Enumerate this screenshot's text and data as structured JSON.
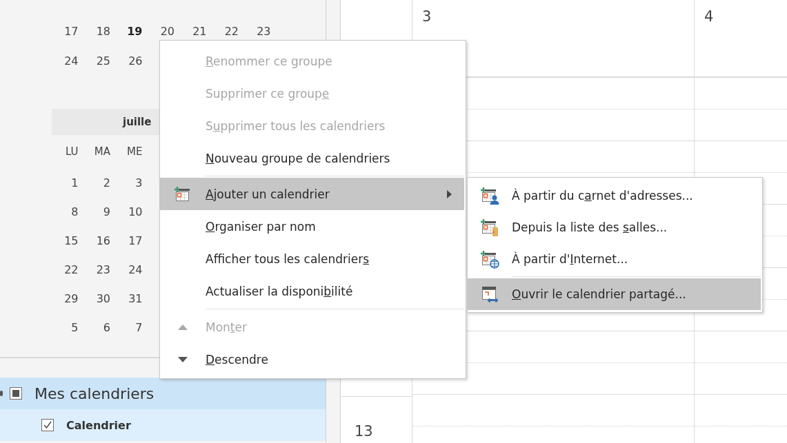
{
  "mini_calendar": {
    "rows_top": [
      {
        "days": [
          {
            "label": "17",
            "today": false
          },
          {
            "label": "18",
            "today": false
          },
          {
            "label": "19",
            "today": true
          },
          {
            "label": "20",
            "today": false
          },
          {
            "label": "21",
            "today": false
          },
          {
            "label": "22",
            "today": false
          },
          {
            "label": "23",
            "today": false
          }
        ]
      },
      {
        "days": [
          {
            "label": "24",
            "today": false
          },
          {
            "label": "25",
            "today": false
          },
          {
            "label": "26",
            "today": false
          }
        ]
      }
    ],
    "month_title": "juille",
    "weekdays": [
      "LU",
      "MA",
      "ME"
    ],
    "rows": [
      {
        "days": [
          {
            "label": "1",
            "today": false
          },
          {
            "label": "2",
            "today": false
          },
          {
            "label": "3",
            "today": false
          }
        ]
      },
      {
        "days": [
          {
            "label": "8",
            "today": false
          },
          {
            "label": "9",
            "today": false
          },
          {
            "label": "10",
            "today": false
          }
        ]
      },
      {
        "days": [
          {
            "label": "15",
            "today": false
          },
          {
            "label": "16",
            "today": false
          },
          {
            "label": "17",
            "today": false
          }
        ]
      },
      {
        "days": [
          {
            "label": "22",
            "today": false
          },
          {
            "label": "23",
            "today": false
          },
          {
            "label": "24",
            "today": false
          }
        ]
      },
      {
        "days": [
          {
            "label": "29",
            "today": false
          },
          {
            "label": "30",
            "today": false
          },
          {
            "label": "31",
            "today": false
          }
        ]
      },
      {
        "days": [
          {
            "label": "5",
            "today": false
          },
          {
            "label": "6",
            "today": false
          },
          {
            "label": "7",
            "today": false
          }
        ]
      }
    ]
  },
  "calendar_groups": [
    {
      "label": "Mes calendriers",
      "checked": true,
      "partial": true,
      "calendars": [
        {
          "label": "Calendrier",
          "checked": true
        }
      ]
    }
  ],
  "day_columns": [
    {
      "date": "3"
    },
    {
      "date": "4"
    }
  ],
  "time_labels": [
    "13"
  ],
  "context_menu": {
    "items": [
      {
        "kind": "item",
        "access_key": "R",
        "label_end": "enommer ce groupe",
        "disabled": true,
        "selected": false
      },
      {
        "kind": "item",
        "label_start": "Supprimer ce group",
        "access_key": "e",
        "disabled": true,
        "selected": false
      },
      {
        "kind": "item",
        "label_start": "S",
        "access_key": "u",
        "label_end": "pprimer tous les calendriers",
        "disabled": true,
        "selected": false
      },
      {
        "kind": "item",
        "access_key": "N",
        "label_end": "ouveau groupe de calendriers",
        "disabled": false,
        "selected": false
      },
      {
        "kind": "separator"
      },
      {
        "kind": "item",
        "access_key": "A",
        "label_end": "jouter un calendrier",
        "disabled": false,
        "selected": true,
        "submenu": true
      },
      {
        "kind": "item",
        "access_key": "O",
        "label_end": "rganiser par nom",
        "disabled": false,
        "selected": false
      },
      {
        "kind": "item",
        "label_start": "Afficher tous les calendrier",
        "access_key": "s",
        "disabled": false,
        "selected": false
      },
      {
        "kind": "item",
        "label_start": "Actualiser la disponi",
        "access_key": "b",
        "label_end": "ilité",
        "disabled": false,
        "selected": false
      },
      {
        "kind": "separator"
      },
      {
        "kind": "item",
        "label_start": "Mon",
        "access_key": "t",
        "label_end": "er",
        "disabled": true,
        "selected": false
      },
      {
        "kind": "item",
        "access_key": "D",
        "label_end": "escendre",
        "disabled": false,
        "selected": false
      }
    ]
  },
  "submenu": {
    "items": [
      {
        "kind": "item",
        "label_start": "À partir du c",
        "access_key": "a",
        "label_end": "rnet d'adresses...",
        "disabled": false,
        "selected": false
      },
      {
        "kind": "item",
        "label_start": "Depuis la liste des ",
        "access_key": "s",
        "label_end": "alles...",
        "disabled": false,
        "selected": false
      },
      {
        "kind": "item",
        "label_start": "À partir d'",
        "access_key": "I",
        "label_end": "nternet...",
        "disabled": false,
        "selected": false
      },
      {
        "kind": "separator"
      },
      {
        "kind": "item",
        "access_key": "O",
        "label_end": "uvrir le calendrier partagé...",
        "disabled": false,
        "selected": true
      }
    ]
  }
}
